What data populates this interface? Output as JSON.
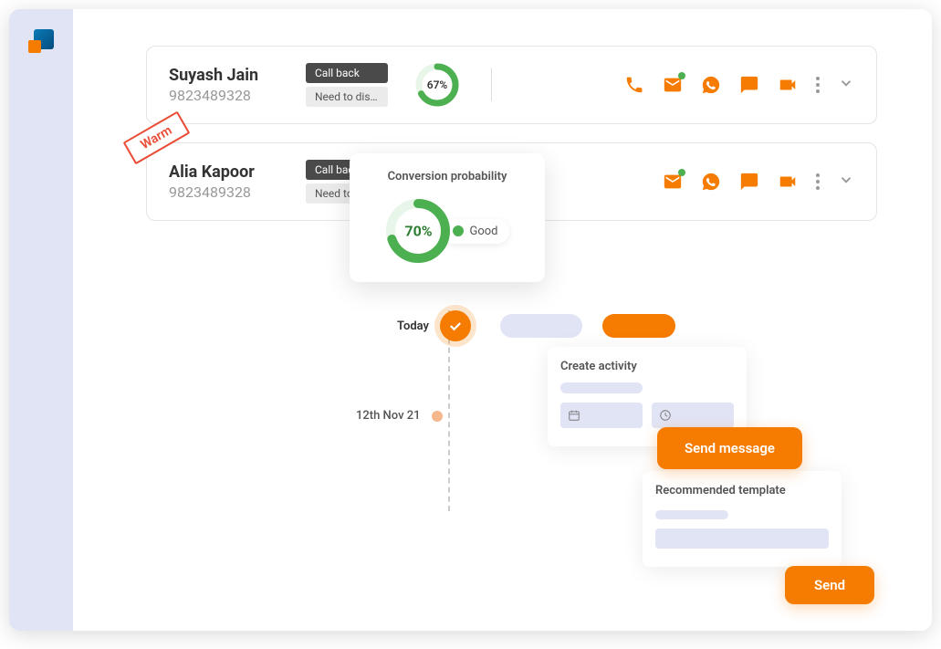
{
  "leads": [
    {
      "name": "Suyash Jain",
      "phone": "9823489328",
      "tag1": "Call back",
      "tag2": "Need to discu...",
      "probability": "67%"
    },
    {
      "name": "Alia Kapoor",
      "phone": "9823489328",
      "tag1": "Call back",
      "tag2": "Need to d",
      "badge": "Warm"
    }
  ],
  "popover": {
    "title": "Conversion probability",
    "value": "70%",
    "label": "Good"
  },
  "timeline": {
    "today": "Today",
    "date": "12th Nov 21"
  },
  "createActivity": {
    "title": "Create activity"
  },
  "sendMessage": "Send message",
  "recommended": {
    "title": "Recommended template"
  },
  "send": "Send"
}
